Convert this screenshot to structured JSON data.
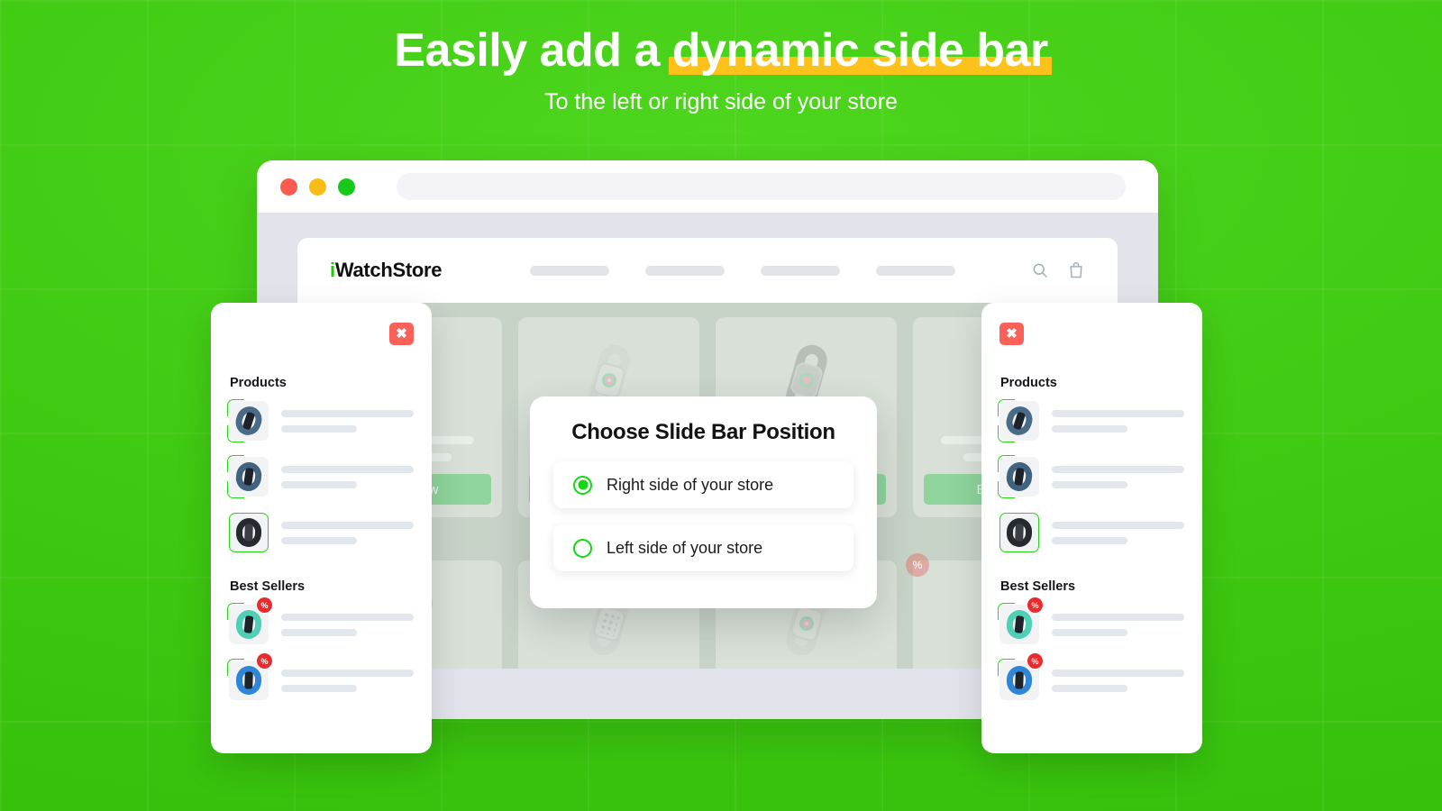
{
  "theme": {
    "bg_green": "#3fcc14",
    "accent_green": "#12d812",
    "highlight_yellow": "#fcc21b",
    "close_red": "#fb6158",
    "badge_red": "#eb2b2b"
  },
  "headline": {
    "part1": "Easily add a ",
    "part2_highlighted": "dynamic side bar",
    "subtitle": "To the left or right side of your store"
  },
  "browser": {
    "traffic_lights": [
      "close-red",
      "minimize-yellow",
      "maximize-green"
    ],
    "url_value": "",
    "url_placeholder": ""
  },
  "store": {
    "logo_i": "i",
    "logo_rest": "WatchStore",
    "nav_items": [
      "",
      "",
      "",
      ""
    ],
    "icons": [
      "search-icon",
      "shopping-bag-icon"
    ],
    "section_title": "Best Sellers",
    "buy_now_label": "Buy Now",
    "discount_badge": "%",
    "products_row1": [
      {
        "tone": "light"
      },
      {
        "tone": "light"
      },
      {
        "tone": "dark"
      },
      {
        "tone": "dotted"
      }
    ],
    "products_row2": [
      {
        "tone": "dark"
      },
      {
        "tone": "dotted"
      },
      {
        "tone": "light"
      },
      {
        "tone": "light"
      }
    ]
  },
  "modal": {
    "title": "Choose Slide Bar Position",
    "options": [
      {
        "label": "Right side of your store",
        "selected": true
      },
      {
        "label": "Left side of your store",
        "selected": false
      }
    ]
  },
  "panel": {
    "close_glyph": "✖",
    "products_title": "Products",
    "best_sellers_title": "Best Sellers",
    "discount_glyph": "%",
    "products": [
      {
        "color": "#4a6b88",
        "border": "corner",
        "badge": false
      },
      {
        "color": "#41637f",
        "border": "corner",
        "badge": false
      },
      {
        "color": "#26292e",
        "border": "full",
        "badge": false
      }
    ],
    "best_sellers": [
      {
        "color": "#4fd0b5",
        "border": "corner",
        "badge": true
      },
      {
        "color": "#2f86d8",
        "border": "corner",
        "badge": true
      }
    ]
  }
}
